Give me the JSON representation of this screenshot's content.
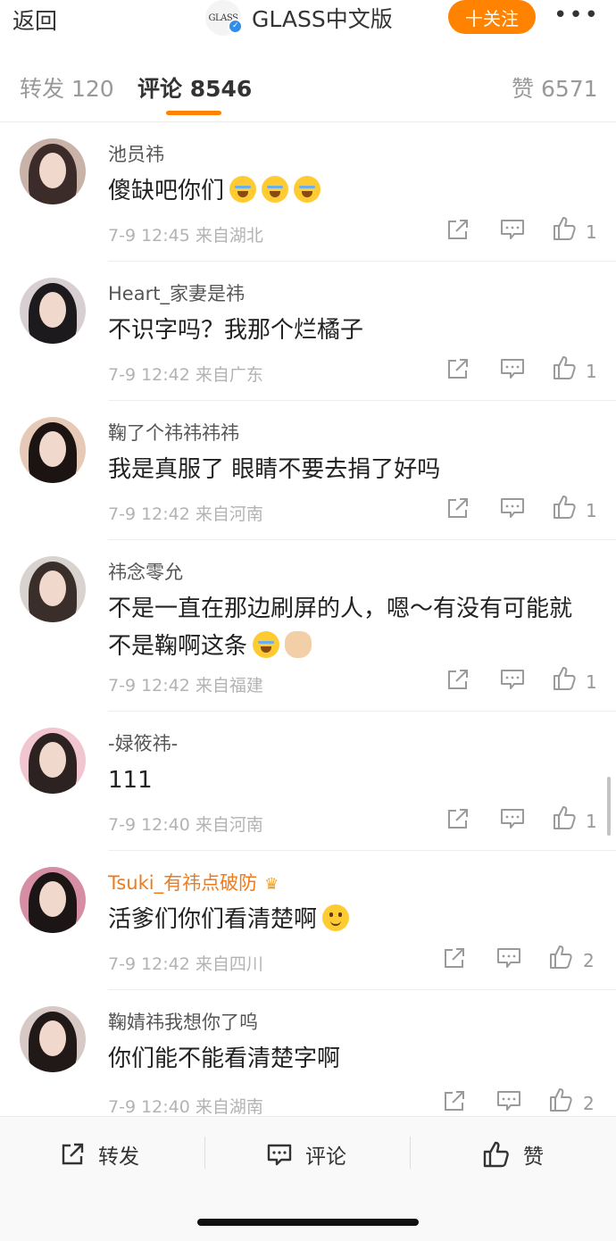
{
  "header": {
    "back_label": "返回",
    "brand_logo_text": "GLASS",
    "brand_name": "GLASS中文版",
    "follow_label": "十关注",
    "more_label": "•••"
  },
  "tabs": {
    "repost": "转发 120",
    "comments": "评论 8546",
    "likes": "赞 6571"
  },
  "comments": [
    {
      "username": "池员祎",
      "text": "傻缺吧你们",
      "emoji": [
        "cry",
        "cry",
        "cry"
      ],
      "meta": "7-9 12:45 来自湖北",
      "likes": "1"
    },
    {
      "username": "Heart_家妻是祎",
      "text": "不识字吗？我那个烂橘子",
      "emoji": [],
      "meta": "7-9 12:42 来自广东",
      "likes": "1"
    },
    {
      "username": "鞠了个祎祎祎祎",
      "text": "我是真服了 眼睛不要去捐了好吗",
      "emoji": [],
      "meta": "7-9 12:42 来自河南",
      "likes": "1"
    },
    {
      "username": "祎念零允",
      "text": "不是一直在那边刷屏的人，嗯～有没有可能就不是鞠啊这条",
      "emoji": [
        "cry",
        "ok"
      ],
      "meta": "7-9 12:42 来自福建",
      "likes": "1"
    },
    {
      "username": "-娽筱祎-",
      "text": "111",
      "emoji": [],
      "meta": "7-9 12:40 来自河南",
      "likes": "1"
    },
    {
      "username": "Tsuki_有祎点破防",
      "text": "活爹们你们看清楚啊",
      "emoji": [
        "smile"
      ],
      "meta": "7-9 12:42 来自四川",
      "likes": "2"
    },
    {
      "username": "鞠婧祎我想你了呜",
      "text": "你们能不能看清楚字啊",
      "emoji": [],
      "meta": "7-9 12:40 来自湖南",
      "likes": "2"
    }
  ],
  "bottom_bar": {
    "repost_label": "转发",
    "comment_label": "评论",
    "like_label": "赞"
  },
  "colors": {
    "accent": "#ff8200",
    "vip_name": "#f07a1a",
    "meta": "#b3b3b3"
  }
}
